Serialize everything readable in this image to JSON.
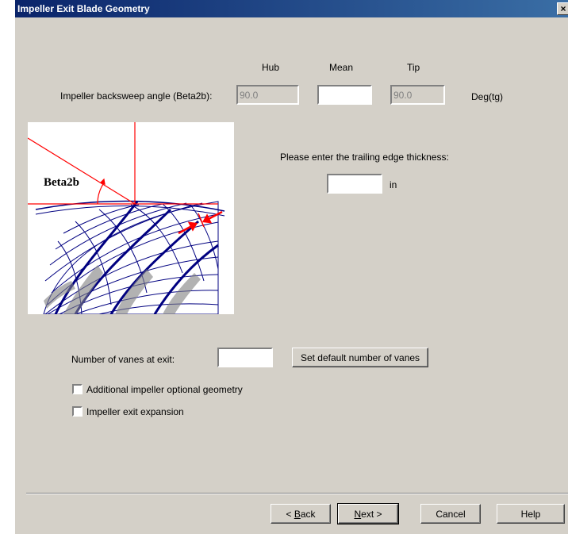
{
  "window": {
    "title": "Impeller Exit Blade Geometry",
    "close_glyph": "×"
  },
  "backsweep": {
    "col_hub": "Hub",
    "col_mean": "Mean",
    "col_tip": "Tip",
    "label": "Impeller backsweep angle (Beta2b):",
    "hub_value": "90.0",
    "mean_value": "",
    "tip_value": "90.0",
    "unit": "Deg(tg)"
  },
  "trailing_edge": {
    "prompt": "Please enter the trailing edge thickness:",
    "value": "",
    "unit": "in"
  },
  "diagram": {
    "angle_label": "Beta2b"
  },
  "vanes": {
    "label": "Number of vanes at exit:",
    "value": "",
    "default_button": "Set default number of vanes"
  },
  "options": {
    "additional_geometry": {
      "label": "Additional impeller optional geometry",
      "checked": false
    },
    "exit_expansion": {
      "label": "Impeller exit expansion",
      "checked": false
    }
  },
  "footer": {
    "back_prefix": "< ",
    "back_key": "B",
    "back_rest": "ack",
    "next_key": "N",
    "next_rest": "ext >",
    "cancel": "Cancel",
    "help": "Help"
  },
  "colors": {
    "title_bar": "#0a246a",
    "dialog_bg": "#d4d0c8",
    "blade_lines": "#000080",
    "angle_lines": "#ff0000"
  }
}
